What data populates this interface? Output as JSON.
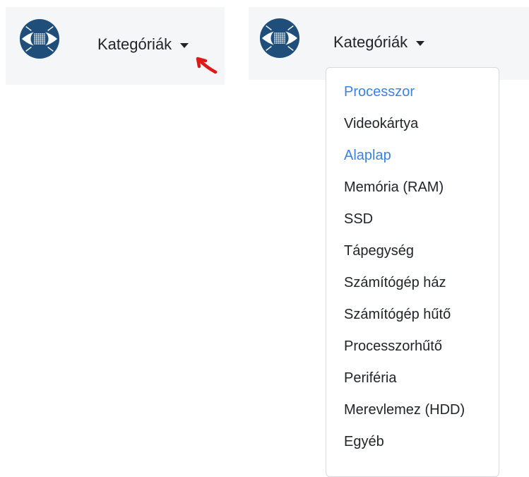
{
  "colors": {
    "navbar_bg": "#f5f6f8",
    "link_blue": "#3b82e6",
    "text": "#212529",
    "annotation_red": "#e01818",
    "logo_blue": "#1f4e7a"
  },
  "left_navbar": {
    "logo_icon": "circuit-eye-logo-icon",
    "dropdown_label": "Kategóriák"
  },
  "right_navbar": {
    "logo_icon": "circuit-eye-logo-icon",
    "dropdown_label": "Kategóriák"
  },
  "dropdown_menu": {
    "items": [
      {
        "label": "Processzor",
        "style": "link"
      },
      {
        "label": "Videokártya",
        "style": "normal"
      },
      {
        "label": "Alaplap",
        "style": "link"
      },
      {
        "label": "Memória (RAM)",
        "style": "normal"
      },
      {
        "label": "SSD",
        "style": "normal"
      },
      {
        "label": "Tápegység",
        "style": "normal"
      },
      {
        "label": "Számítógép ház",
        "style": "normal"
      },
      {
        "label": "Számítógép hűtő",
        "style": "normal"
      },
      {
        "label": "Processzorhűtő",
        "style": "normal"
      },
      {
        "label": "Periféria",
        "style": "normal"
      },
      {
        "label": "Merevlemez (HDD)",
        "style": "normal"
      },
      {
        "label": "Egyéb",
        "style": "normal"
      }
    ]
  }
}
